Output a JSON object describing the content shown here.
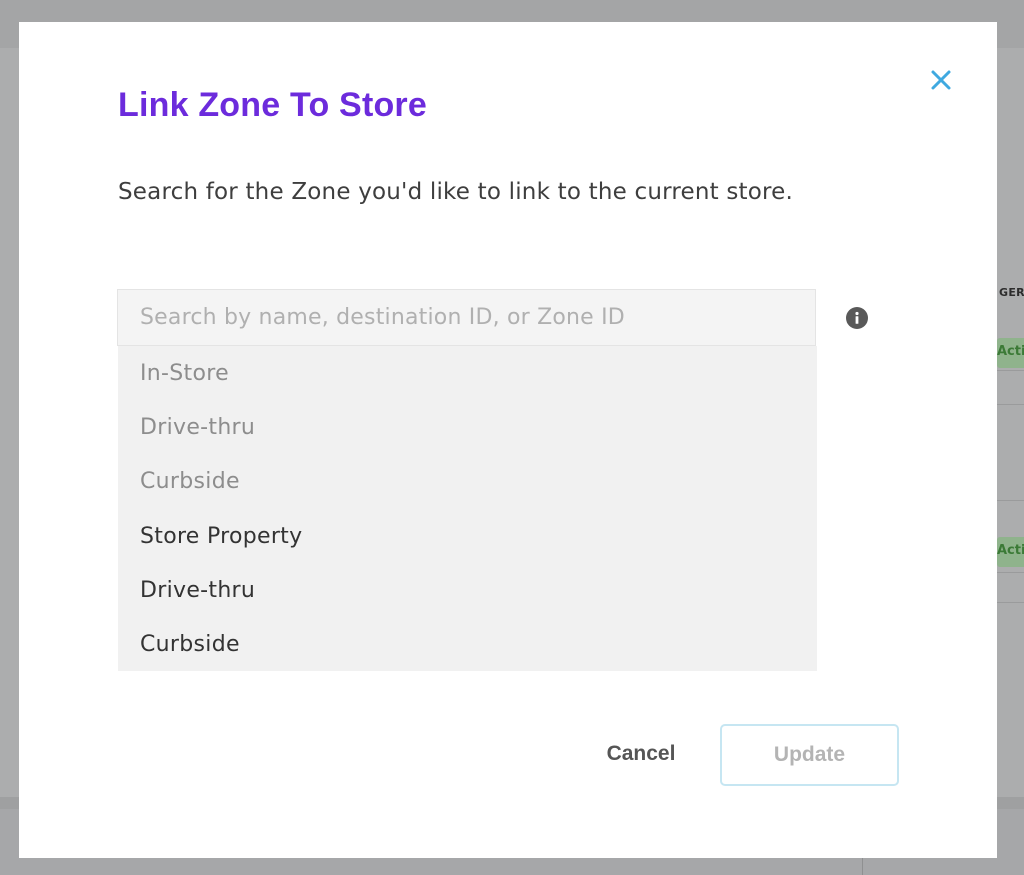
{
  "background": {
    "table_header_fragment": "GER G",
    "status_badges": [
      "Acti",
      "Acti"
    ]
  },
  "modal": {
    "title": "Link Zone To Store",
    "description": "Search for the Zone you'd like to link to the current store.",
    "close_icon": "close-icon",
    "search": {
      "value": "",
      "placeholder": "Search by name, destination ID, or Zone ID"
    },
    "info_icon": "info-icon",
    "dropdown_items": [
      {
        "label": "In-Store",
        "state": "disabled"
      },
      {
        "label": "Drive-thru",
        "state": "disabled"
      },
      {
        "label": "Curbside",
        "state": "disabled"
      },
      {
        "label": "Store Property",
        "state": "enabled"
      },
      {
        "label": "Drive-thru",
        "state": "enabled"
      },
      {
        "label": "Curbside",
        "state": "enabled"
      }
    ],
    "cancel_label": "Cancel",
    "update_label": "Update"
  },
  "colors": {
    "title": "#6c2bdc",
    "close_icon": "#3fa9e0",
    "update_border": "#c6e6f2",
    "overlay": "#a9abad"
  }
}
